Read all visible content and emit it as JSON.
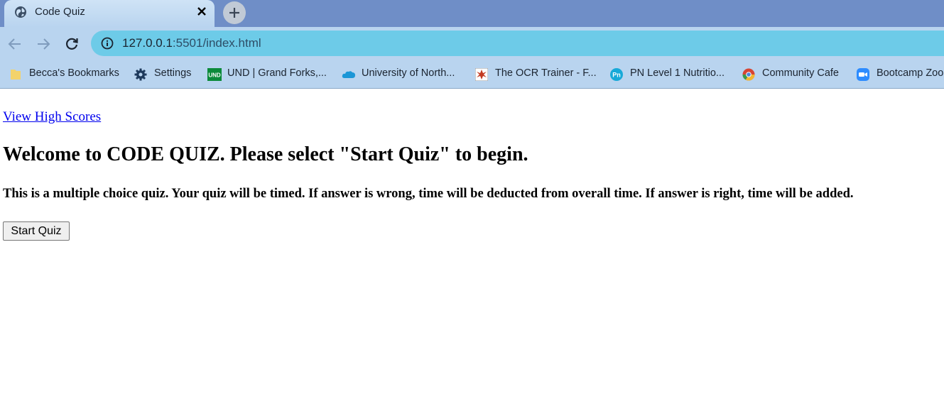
{
  "browser": {
    "tab": {
      "title": "Code Quiz",
      "favicon": "globe-icon"
    },
    "address_bar": {
      "host": "127.0.0.1",
      "path": ":5501/index.html"
    },
    "bookmarks": [
      {
        "label": "Becca's Bookmarks",
        "icon": "folder-icon"
      },
      {
        "label": "Settings",
        "icon": "gear-icon"
      },
      {
        "label": "UND | Grand Forks,...",
        "icon": "und-icon"
      },
      {
        "label": "University of North...",
        "icon": "cloud-icon"
      },
      {
        "label": "The OCR Trainer - F...",
        "icon": "ocr-icon"
      },
      {
        "label": "PN Level 1 Nutritio...",
        "icon": "pn-icon"
      },
      {
        "label": "Community Cafe",
        "icon": "chrome-icon"
      },
      {
        "label": "Bootcamp Zoom",
        "icon": "zoom-icon"
      }
    ]
  },
  "page": {
    "high_scores_link": "View High Scores",
    "welcome_heading": "Welcome to CODE QUIZ. Please select \"Start Quiz\" to begin.",
    "instructions": "This is a multiple choice quiz. Your quiz will be timed. If answer is wrong, time will be deducted from overall time. If answer is right, time will be added.",
    "start_button": "Start Quiz"
  }
}
